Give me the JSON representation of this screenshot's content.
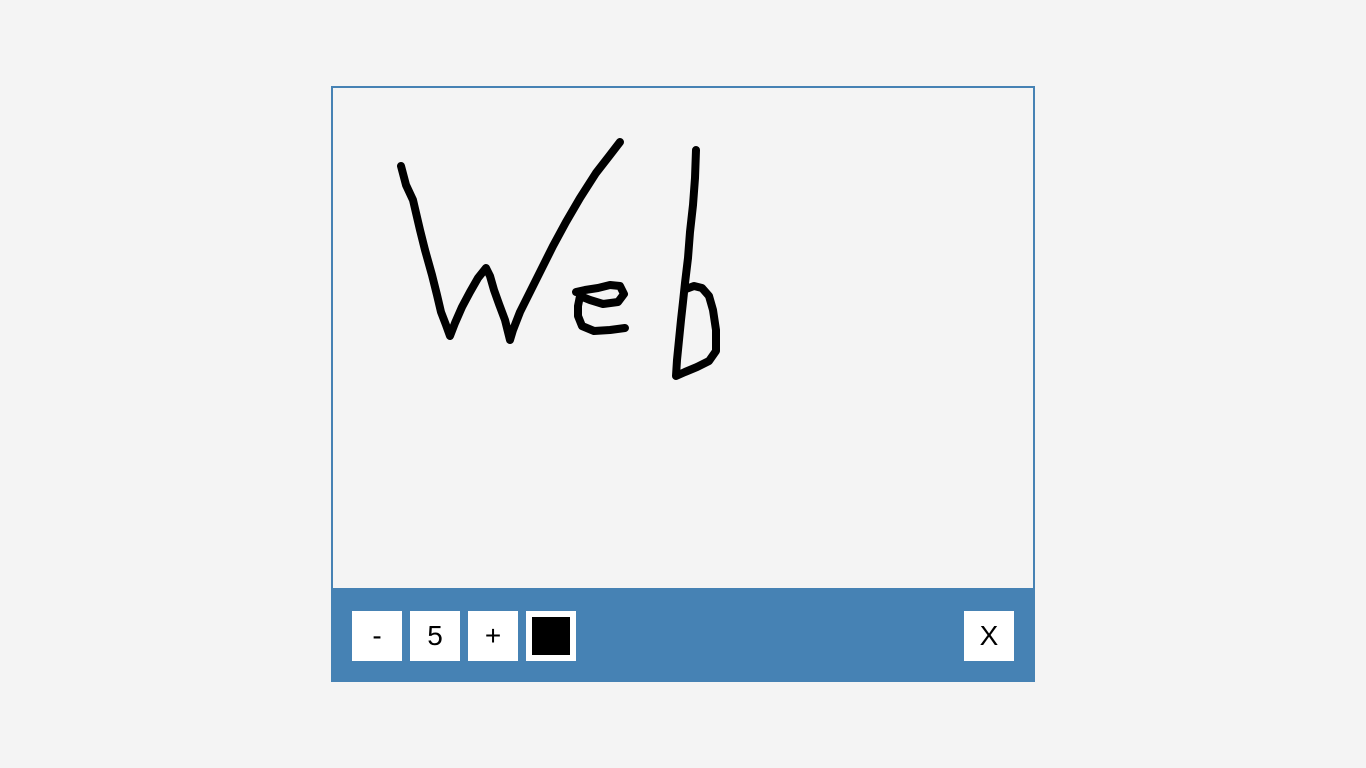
{
  "toolbar": {
    "decrease_label": "-",
    "brush_size": "5",
    "increase_label": "+",
    "close_label": "X",
    "selected_color": "#000000",
    "bar_color": "#4682b4"
  },
  "drawing": {
    "handwritten_text": "Web",
    "stroke_color": "#000000"
  }
}
